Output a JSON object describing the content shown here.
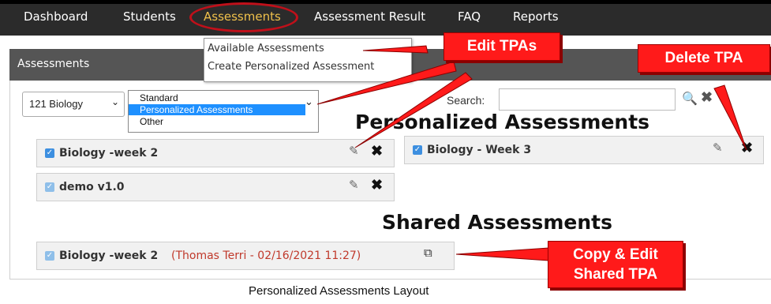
{
  "nav": {
    "items": [
      "Dashboard",
      "Students",
      "Assessments",
      "Assessment Result",
      "FAQ",
      "Reports"
    ],
    "active": "Assessments"
  },
  "assessments_menu": {
    "items": [
      "Available Assessments",
      "Create Personalized Assessment"
    ]
  },
  "panel": {
    "title": "Assessments",
    "course_select": "121 Biology",
    "type_options": [
      "Standard",
      "Personalized Assessments",
      "Other"
    ],
    "selected_type": "Personalized Assessments",
    "search_label": "Search:",
    "search_value": ""
  },
  "personalized": {
    "heading": "Personalized Assessments",
    "cards": [
      {
        "name": "Biology -week 2"
      },
      {
        "name": "Biology - Week 3"
      },
      {
        "name": "demo v1.0"
      }
    ]
  },
  "shared": {
    "heading": "Shared Assessments",
    "cards": [
      {
        "name": "Biology -week 2",
        "meta": "(Thomas Terri - 02/16/2021 11:27)"
      }
    ]
  },
  "callouts": {
    "edit": "Edit TPAs",
    "delete": "Delete TPA",
    "copy_line1": "Copy & Edit",
    "copy_line2": "Shared TPA"
  },
  "caption": "Personalized Assessments Layout",
  "colors": {
    "nav_bg": "#2b2b2b",
    "active_nav": "#f0c14b",
    "callout": "#ff1a1a",
    "highlight": "#1e90ff",
    "meta_text": "#c0392b"
  }
}
